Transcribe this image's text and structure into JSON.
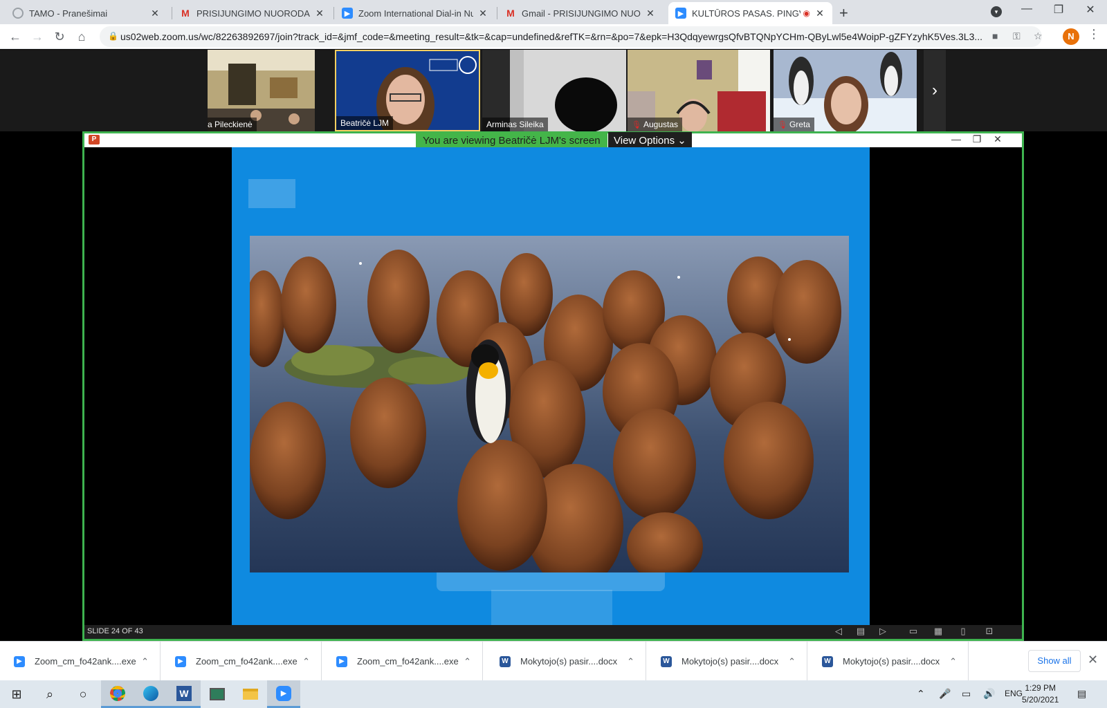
{
  "browser": {
    "tabs": [
      {
        "title": "TAMO - Pranešimai",
        "favicon": "tamo-icon"
      },
      {
        "title": "PRISIJUNGIMO NUORODA - npil",
        "favicon": "gmail-icon"
      },
      {
        "title": "Zoom International Dial-in Numb",
        "favicon": "zoom-icon"
      },
      {
        "title": "Gmail - PRISIJUNGIMO NUOROD",
        "favicon": "gmail-icon"
      },
      {
        "title": "KULTŪROS PASAS. PINGVINA",
        "favicon": "zoom-icon",
        "active": true
      }
    ],
    "url": "us02web.zoom.us/wc/82263892697/join?track_id=&jmf_code=&meeting_result=&tk=&cap=undefined&refTK=&rn=&po=7&epk=H3QdqyewrgsQfvBTQNpYCHm-QByLwl5e4WoipP-gZFYzyhK5Ves.3L3...",
    "profile_initial": "N"
  },
  "zoom": {
    "participants": [
      {
        "name": "Nida Pileckienė",
        "muted": false
      },
      {
        "name": "Beatričė LJM",
        "muted": false,
        "active": true
      },
      {
        "name": "Arminas Sileika",
        "muted": false
      },
      {
        "name": "Augustas",
        "muted": true
      },
      {
        "name": "Greta",
        "muted": true
      }
    ],
    "share_banner": "You are viewing Beatričė LJM's screen",
    "view_options": "View Options",
    "slide_counter": "SLIDE 24 OF 43"
  },
  "downloads": {
    "items": [
      {
        "name": "Zoom_cm_fo42ank....exe",
        "type": "zoom"
      },
      {
        "name": "Zoom_cm_fo42ank....exe",
        "type": "zoom"
      },
      {
        "name": "Zoom_cm_fo42ank....exe",
        "type": "zoom"
      },
      {
        "name": "Mokytojo(s) pasir....docx",
        "type": "word"
      },
      {
        "name": "Mokytojo(s) pasir....docx",
        "type": "word"
      },
      {
        "name": "Mokytojo(s) pasir....docx",
        "type": "word"
      }
    ],
    "show_all": "Show all"
  },
  "taskbar": {
    "language": "ENG",
    "time": "1:29 PM",
    "date": "5/20/2021"
  },
  "colors": {
    "zoom_blue": "#2d8cff",
    "share_border": "#3eb34f",
    "slide_bg": "#0f8ae0"
  }
}
